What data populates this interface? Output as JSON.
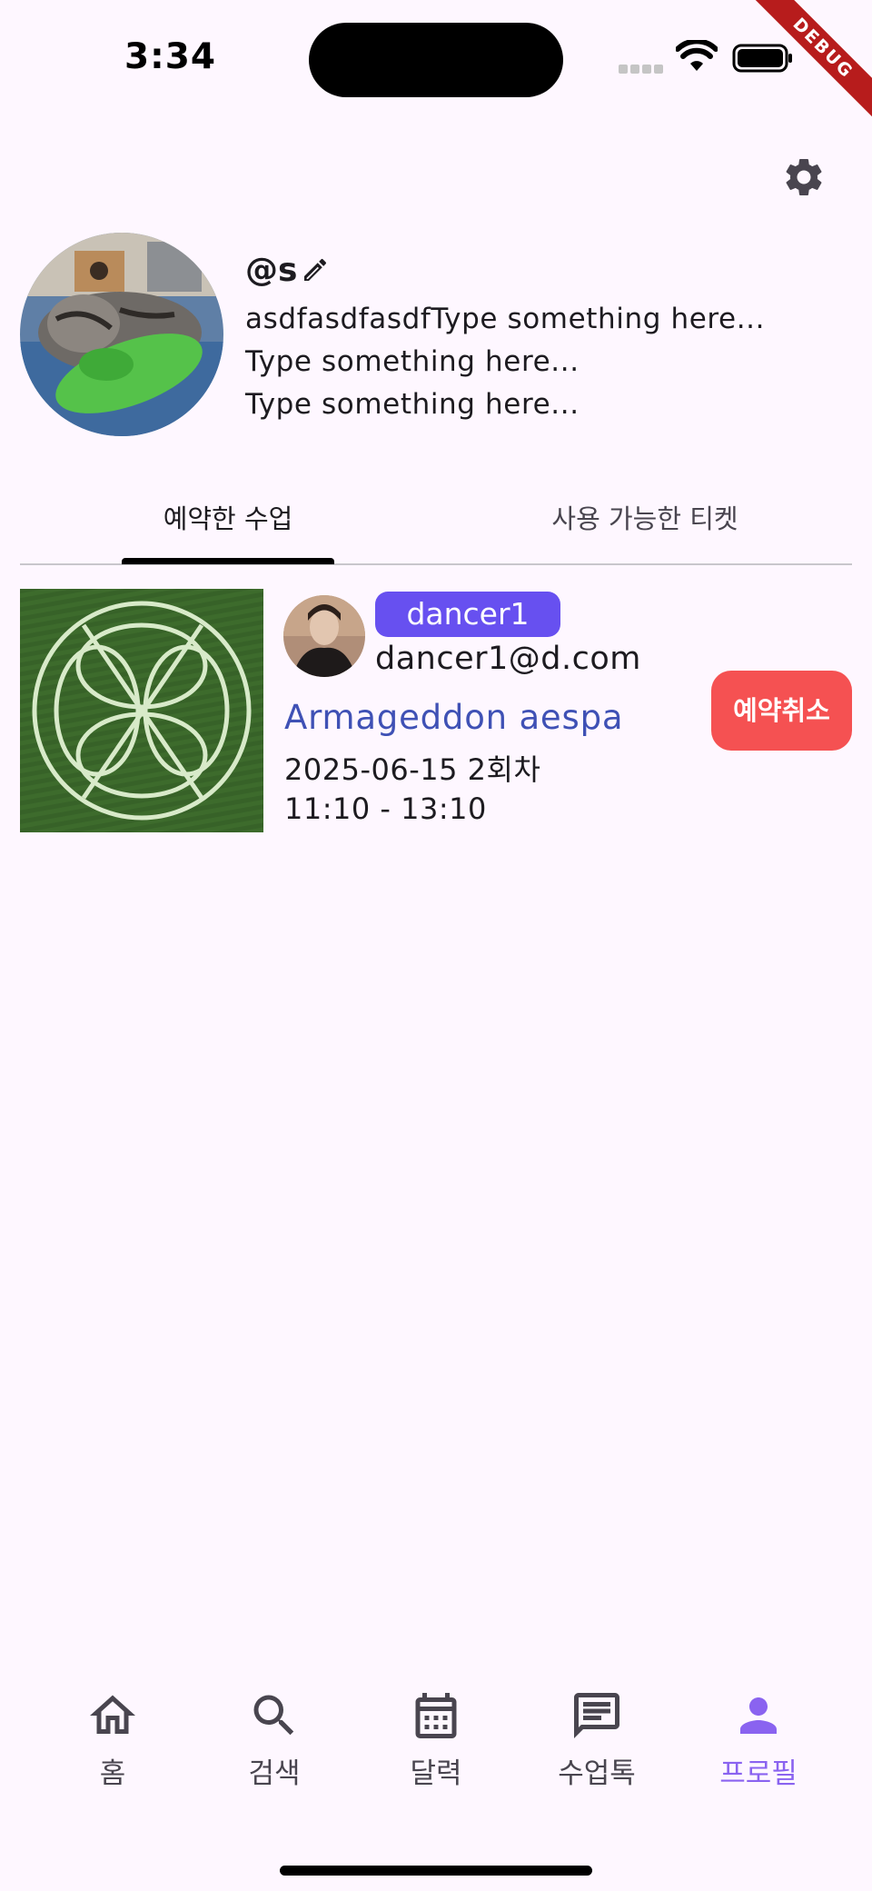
{
  "status_bar": {
    "time": "3:34",
    "debug_label": "DEBUG"
  },
  "profile": {
    "username": "@s",
    "bio_lines": [
      "asdfasdfasdfType something here...",
      "Type something here...",
      "Type something here..."
    ]
  },
  "tabs": [
    {
      "label": "예약한 수업",
      "selected": true
    },
    {
      "label": "사용 가능한 티켓",
      "selected": false
    }
  ],
  "reservation": {
    "instructor_name": "dancer1",
    "instructor_email": "dancer1@d.com",
    "class_title": "Armageddon aespa",
    "date_session": "2025-06-15 2회차",
    "time_range": "11:10 - 13:10",
    "cancel_label": "예약취소"
  },
  "bottom_nav": {
    "items": [
      {
        "label": "홈",
        "icon": "home-icon",
        "active": false
      },
      {
        "label": "검색",
        "icon": "search-icon",
        "active": false
      },
      {
        "label": "달력",
        "icon": "calendar-icon",
        "active": false
      },
      {
        "label": "수업톡",
        "icon": "chat-icon",
        "active": false
      },
      {
        "label": "프로필",
        "icon": "person-icon",
        "active": true
      }
    ]
  },
  "colors": {
    "background": "#FEF7FF",
    "accent": "#8A63F0",
    "badge": "#6750F0",
    "cancel": "#F55152",
    "title_link": "#3F51B5"
  }
}
